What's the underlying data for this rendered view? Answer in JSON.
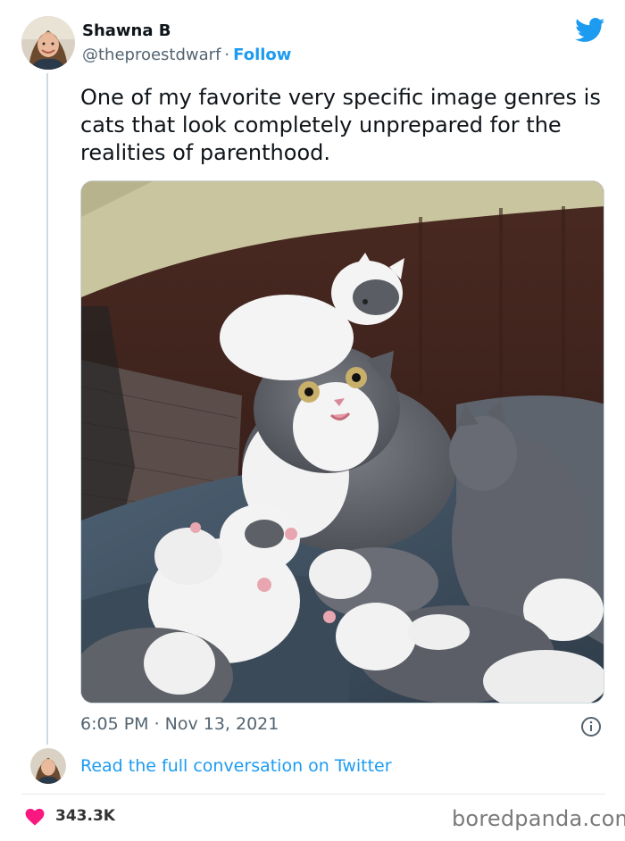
{
  "author": {
    "display_name": "Shawna B",
    "handle": "@theproestdwarf",
    "separator": "·",
    "follow_label": "Follow"
  },
  "tweet": {
    "text": "One of my favorite very specific image genres is cats that look completely unprepared for the realities of parenthood.",
    "time": "6:05 PM",
    "separator": "·",
    "date": "Nov 13, 2021"
  },
  "conversation": {
    "link_label": "Read the full conversation on Twitter"
  },
  "engagement": {
    "likes": "343.3K"
  },
  "watermark": "boredpanda.com",
  "icons": {
    "brand": "twitter-bird-icon",
    "info": "info-icon",
    "like": "heart-icon"
  },
  "colors": {
    "accent": "#1d9bf0",
    "heart": "#f91880",
    "secondary_text": "#536471",
    "primary_text": "#0f1419"
  }
}
